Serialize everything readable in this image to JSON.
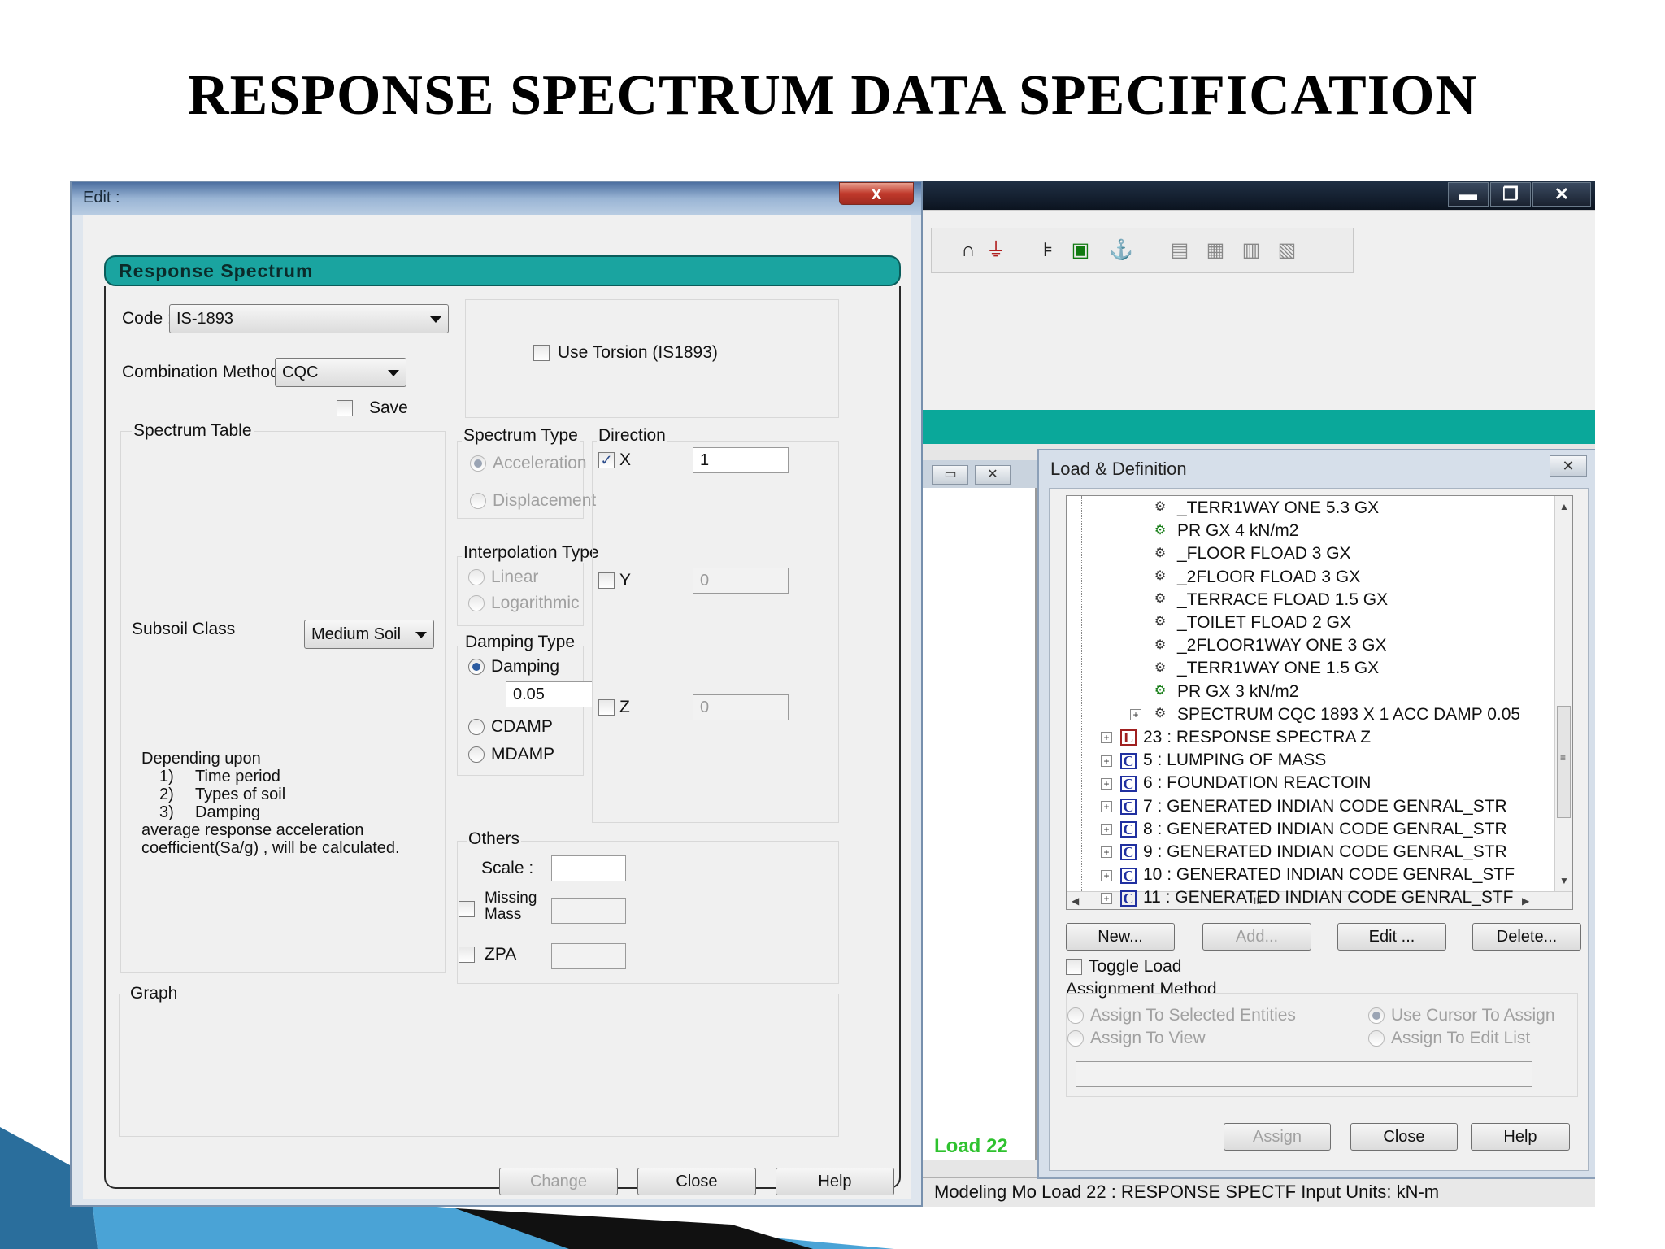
{
  "slide": {
    "title": "RESPONSE  SPECTRUM  DATA  SPECIFICATION"
  },
  "edit_dialog": {
    "window_title": "Edit :",
    "close_glyph": "x",
    "header": "Response Spectrum",
    "code_label": "Code :",
    "code_value": "IS-1893",
    "combination_label": "Combination Method",
    "combination_value": "CQC",
    "save_label": "Save",
    "use_torsion_label": "Use Torsion (IS1893)",
    "spectrum_table_label": "Spectrum Table",
    "subsoil_label": "Subsoil Class",
    "subsoil_value": "Medium Soil",
    "note_lines": [
      "Depending upon",
      "1)",
      "Time period",
      "2)",
      "Types of soil",
      "3)",
      "Damping",
      "average response acceleration",
      "coefficient(Sa/g) , will be calculated."
    ],
    "graph_label": "Graph",
    "spectrum_type": {
      "title": "Spectrum Type",
      "acceleration": "Acceleration",
      "displacement": "Displacement"
    },
    "interpolation_type": {
      "title": "Interpolation Type",
      "linear": "Linear",
      "logarithmic": "Logarithmic"
    },
    "damping_type": {
      "title": "Damping Type",
      "damping": "Damping",
      "damping_value": "0.05",
      "cdamp": "CDAMP",
      "mdamp": "MDAMP"
    },
    "direction": {
      "title": "Direction",
      "x_label": "X",
      "x_value": "1",
      "y_label": "Y",
      "y_value": "0",
      "z_label": "Z",
      "z_value": "0",
      "check_glyph": "✓"
    },
    "others": {
      "title": "Others",
      "scale_label": "Scale :",
      "missing_mass_label_1": "Missing",
      "missing_mass_label_2": "Mass",
      "zpa_label": "ZPA"
    },
    "buttons": {
      "change": "Change",
      "close": "Close",
      "help": "Help"
    }
  },
  "main_window": {
    "buttons": {
      "minimize": "▬",
      "restore": "❐",
      "close": "✕"
    },
    "toolbar_icons": [
      "arch-icon",
      "boat-icon",
      "tree-icon",
      "floppy-icon",
      "anchor-icon",
      "save-icon",
      "open-icon",
      "disk-icon",
      "export-icon"
    ],
    "toolbar_glyphs": [
      "∩",
      "⏚",
      "⊧",
      "▣",
      "⚓",
      "▤",
      "▦",
      "▥",
      "▧"
    ],
    "view_buttons": [
      "▭",
      "✕"
    ],
    "load_label": "Load 22",
    "status": "Modeling Mo  Load 22 : RESPONSE SPECTF  Input Units:   kN-m"
  },
  "load_definition": {
    "title": "Load & Definition",
    "close_glyph": "✕",
    "node_glyph": "⚙",
    "expander_glyph": "+",
    "scroll_glyphs": {
      "up": "▲",
      "down": "▼",
      "left": "◀",
      "right": "▶",
      "thumb": "≡",
      "hthumb": "III"
    },
    "tree_items": [
      {
        "text": "_TERR1WAY ONE 5.3 GX",
        "icon": "gear",
        "level": 2,
        "expand": false
      },
      {
        "text": "PR GX 4  kN/m2",
        "icon": "gear-green",
        "level": 2,
        "expand": false
      },
      {
        "text": "_FLOOR FLOAD 3 GX",
        "icon": "gear",
        "level": 2,
        "expand": false
      },
      {
        "text": "_2FLOOR FLOAD 3 GX",
        "icon": "gear",
        "level": 2,
        "expand": false
      },
      {
        "text": "_TERRACE FLOAD 1.5 GX",
        "icon": "gear",
        "level": 2,
        "expand": false
      },
      {
        "text": "_TOILET FLOAD 2 GX",
        "icon": "gear",
        "level": 2,
        "expand": false
      },
      {
        "text": "_2FLOOR1WAY ONE 3 GX",
        "icon": "gear",
        "level": 2,
        "expand": false
      },
      {
        "text": "_TERR1WAY ONE 1.5 GX",
        "icon": "gear",
        "level": 2,
        "expand": false
      },
      {
        "text": "PR GX 3  kN/m2",
        "icon": "gear-green",
        "level": 2,
        "expand": false
      },
      {
        "text": "SPECTRUM CQC 1893 X 1 ACC DAMP 0.05",
        "icon": "gear",
        "level": 2,
        "expand": true
      },
      {
        "text": "23 : RESPONSE SPECTRA Z",
        "icon": "L",
        "level": 1,
        "expand": true
      },
      {
        "text": "5 : LUMPING OF MASS",
        "icon": "C",
        "level": 1,
        "expand": true
      },
      {
        "text": "6 : FOUNDATION REACTOIN",
        "icon": "C",
        "level": 1,
        "expand": true
      },
      {
        "text": "7 : GENERATED INDIAN CODE GENRAL_STR",
        "icon": "C",
        "level": 1,
        "expand": true
      },
      {
        "text": "8 : GENERATED INDIAN CODE GENRAL_STR",
        "icon": "C",
        "level": 1,
        "expand": true
      },
      {
        "text": "9 : GENERATED INDIAN CODE GENRAL_STR",
        "icon": "C",
        "level": 1,
        "expand": true
      },
      {
        "text": "10 : GENERATED INDIAN CODE GENRAL_STF",
        "icon": "C",
        "level": 1,
        "expand": true
      },
      {
        "text": "11 : GENERATED INDIAN CODE GENRAL_STF",
        "icon": "C",
        "level": 1,
        "expand": true
      }
    ],
    "buttons": {
      "new": "New...",
      "add": "Add...",
      "edit": "Edit ...",
      "delete": "Delete..."
    },
    "toggle_load": "Toggle Load",
    "assignment_method": "Assignment Method",
    "assign_selected": "Assign To Selected Entities",
    "use_cursor": "Use Cursor To Assign",
    "assign_view": "Assign To View",
    "assign_edit_list": "Assign To Edit List",
    "bottom_buttons": {
      "assign": "Assign",
      "close": "Close",
      "help": "Help"
    }
  },
  "colors": {
    "teal": "#1aa4a0",
    "title_bar_dark": "#0c1420",
    "window_bg": "#f0f0f0"
  }
}
